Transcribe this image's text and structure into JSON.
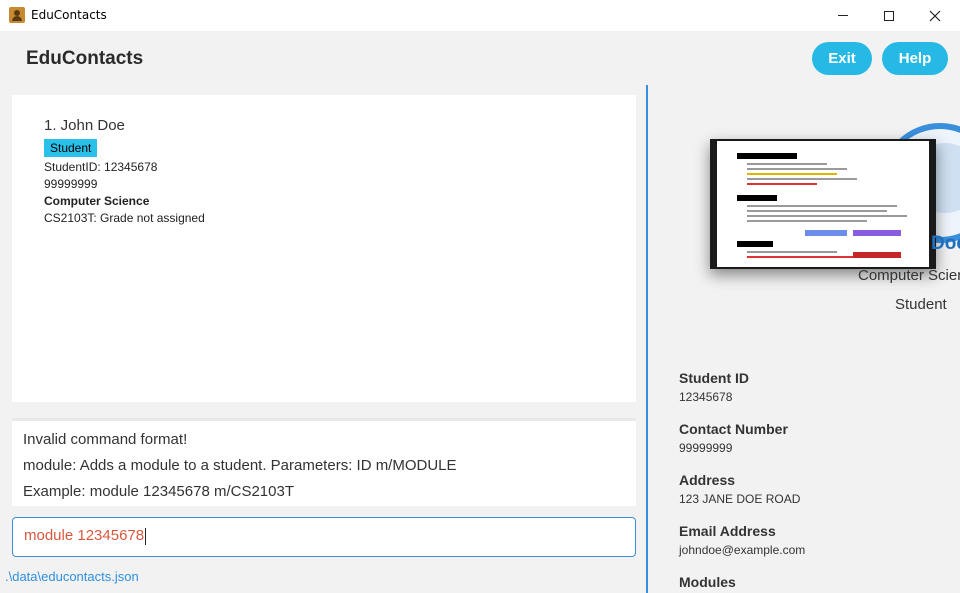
{
  "window": {
    "title": "EduContacts",
    "app_icon": "contacts-book-icon"
  },
  "header": {
    "app_name": "EduContacts",
    "exit_label": "Exit",
    "help_label": "Help",
    "accent_color": "#27b9e6"
  },
  "person_list": [
    {
      "index_name": "1. John Doe",
      "tag": "Student",
      "student_id_line": "StudentID: 12345678",
      "phone": "99999999",
      "course": "Computer Science",
      "module_line": "CS2103T: Grade not assigned"
    }
  ],
  "result_display": {
    "lines": [
      "Invalid command format!",
      "module: Adds a module to a student. Parameters: ID m/MODULE",
      "Example: module 12345678 m/CS2103T"
    ]
  },
  "command_box": {
    "value": "module 12345678"
  },
  "status_bar": {
    "file_path": ".\\data\\educontacts.json"
  },
  "details": {
    "name": "Doe",
    "course": "Computer Science",
    "role": "Student",
    "fields": [
      {
        "label": "Student ID",
        "value": "12345678"
      },
      {
        "label": "Contact Number",
        "value": "99999999"
      },
      {
        "label": "Address",
        "value": "123 JANE DOE ROAD"
      },
      {
        "label": "Email Address",
        "value": "johndoe@example.com"
      },
      {
        "label": "Modules",
        "value": ""
      }
    ]
  }
}
